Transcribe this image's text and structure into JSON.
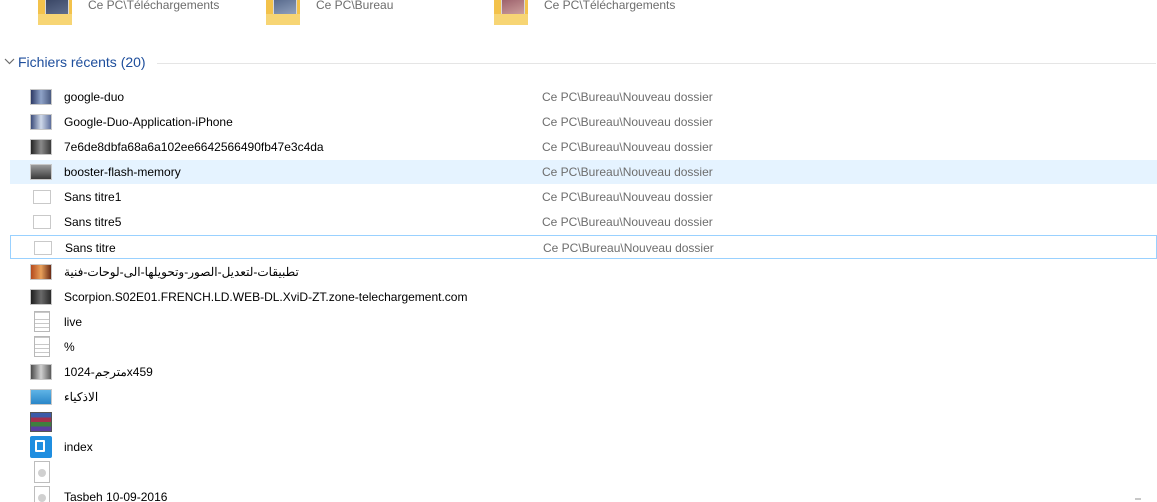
{
  "pinned": [
    {
      "location": "Ce PC\\Téléchargements",
      "thumb_color": "#3b4a6b"
    },
    {
      "location": "Ce PC\\Bureau",
      "thumb_color": "#6a7fa1"
    },
    {
      "location": "Ce PC\\Téléchargements",
      "thumb_color": "#b46a7a"
    }
  ],
  "group": {
    "title": "Fichiers récents (20)",
    "accent": "#1e4e9c"
  },
  "files": [
    {
      "name": "google-duo",
      "location": "Ce PC\\Bureau\\Nouveau dossier",
      "icon": "image-icon",
      "thumb": "linear-gradient(90deg,#2d3a66,#8fa3c8,#4a5a80)"
    },
    {
      "name": "Google-Duo-Application-iPhone",
      "location": "Ce PC\\Bureau\\Nouveau dossier",
      "icon": "image-icon",
      "thumb": "linear-gradient(90deg,#3b4c7a,#cfd9ea,#5d6e9b)"
    },
    {
      "name": "7e6de8dbfa68a6a102ee6642566490fb47e3c4da",
      "location": "Ce PC\\Bureau\\Nouveau dossier",
      "icon": "image-icon",
      "thumb": "linear-gradient(90deg,#242424,#8a8a8a,#3a3a3a)"
    },
    {
      "name": "booster-flash-memory",
      "location": "Ce PC\\Bureau\\Nouveau dossier",
      "icon": "image-icon",
      "thumb": "linear-gradient(180deg,#9a9a9a,#3a3a3a)"
    },
    {
      "name": "Sans titre1",
      "location": "Ce PC\\Bureau\\Nouveau dossier",
      "icon": "blank-image-icon",
      "thumb": ""
    },
    {
      "name": "Sans titre5",
      "location": "Ce PC\\Bureau\\Nouveau dossier",
      "icon": "blank-image-icon",
      "thumb": ""
    },
    {
      "name": "Sans titre",
      "location": "Ce PC\\Bureau\\Nouveau dossier",
      "icon": "blank-image-icon",
      "thumb": ""
    },
    {
      "name": "تطبيقات-لتعديل-الصور-وتحويلها-الى-لوحات-فنية",
      "location": "",
      "icon": "image-icon",
      "thumb": "linear-gradient(90deg,#b44a1e,#e8a05a,#6a2a14)"
    },
    {
      "name": "Scorpion.S02E01.FRENCH.LD.WEB-DL.XviD-ZT.zone-telechargement.com",
      "location": "",
      "icon": "image-icon",
      "thumb": "linear-gradient(90deg,#1e1e1e,#6a6a6a,#2a2a2a)"
    },
    {
      "name": "live",
      "location": "",
      "icon": "text-file-icon",
      "thumb": ""
    },
    {
      "name": "%",
      "location": "",
      "icon": "text-file-icon",
      "thumb": ""
    },
    {
      "name": "1024-مترجمx459",
      "location": "",
      "icon": "image-icon",
      "thumb": "linear-gradient(90deg,#4a4a4a,#d0d0d0,#5a5a5a)"
    },
    {
      "name": "الاذكياء",
      "location": "",
      "icon": "image-icon",
      "thumb": "linear-gradient(180deg,#5fb4e6,#2a86c8)"
    },
    {
      "name": "",
      "location": "",
      "icon": "archive-icon",
      "thumb": ""
    },
    {
      "name": "index",
      "location": "",
      "icon": "app-icon",
      "thumb": ""
    },
    {
      "name": "",
      "location": "",
      "icon": "generic-file-icon",
      "thumb": ""
    }
  ],
  "partial_last": "Tasbeh 10-09-2016"
}
